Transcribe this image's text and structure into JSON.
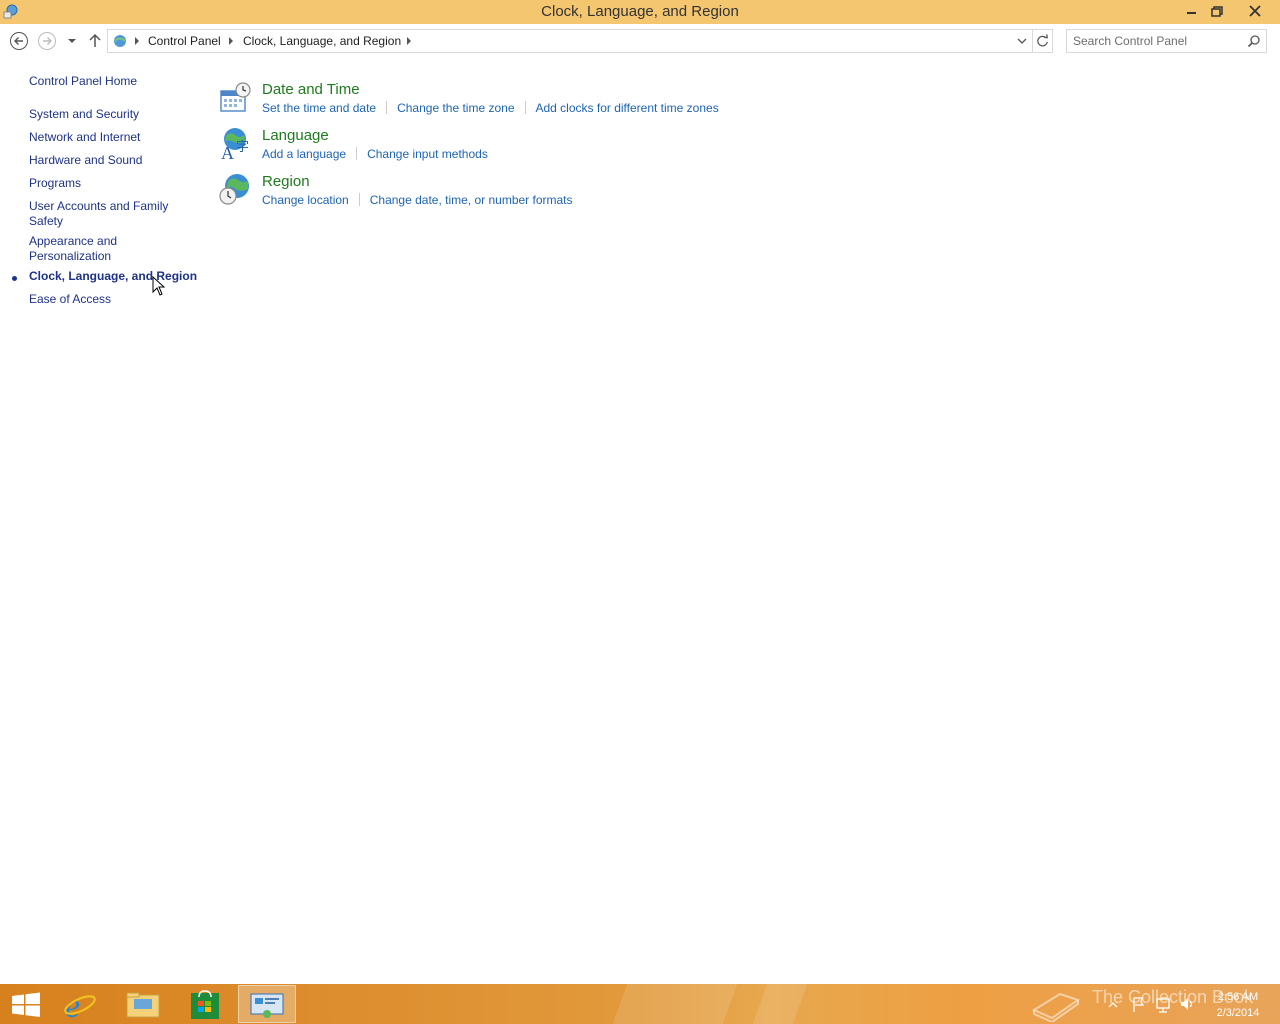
{
  "window": {
    "title": "Clock, Language, and Region"
  },
  "address_bar": {
    "breadcrumbs": [
      "Control Panel",
      "Clock, Language, and Region"
    ]
  },
  "search": {
    "placeholder": "Search Control Panel"
  },
  "sidebar": {
    "home": "Control Panel Home",
    "items": [
      {
        "label": "System and Security"
      },
      {
        "label": "Network and Internet"
      },
      {
        "label": "Hardware and Sound"
      },
      {
        "label": "Programs"
      },
      {
        "label": "User Accounts and Family Safety"
      },
      {
        "label": "Appearance and Personalization"
      },
      {
        "label": "Clock, Language, and Region",
        "active": true
      },
      {
        "label": "Ease of Access"
      }
    ]
  },
  "sections": [
    {
      "title": "Date and Time",
      "icon": "calendar-clock-icon",
      "links": [
        "Set the time and date",
        "Change the time zone",
        "Add clocks for different time zones"
      ]
    },
    {
      "title": "Language",
      "icon": "language-globe-icon",
      "links": [
        "Add a language",
        "Change input methods"
      ]
    },
    {
      "title": "Region",
      "icon": "globe-clock-icon",
      "links": [
        "Change location",
        "Change date, time, or number formats"
      ]
    }
  ],
  "taskbar": {
    "apps": [
      "start",
      "internet-explorer",
      "file-explorer",
      "store",
      "control-panel"
    ],
    "clock_time": "2:56 AM",
    "clock_date": "2/3/2014",
    "watermark": "The Collection Book"
  },
  "colors": {
    "titlebar": "#f3c66f",
    "link": "#1e64b4",
    "section_title": "#1e7b1e",
    "nav_link": "#1e3287"
  }
}
